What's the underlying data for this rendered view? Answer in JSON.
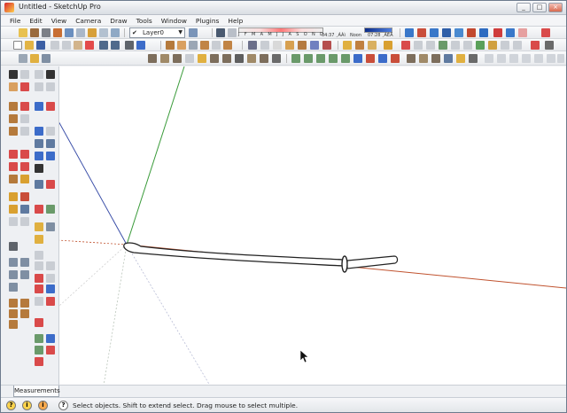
{
  "window": {
    "title": "Untitled - SketchUp Pro",
    "minimize_label": "_",
    "maximize_label": "□",
    "close_label": "×"
  },
  "menu": [
    {
      "label": "File"
    },
    {
      "label": "Edit"
    },
    {
      "label": "View"
    },
    {
      "label": "Camera"
    },
    {
      "label": "Draw"
    },
    {
      "label": "Tools"
    },
    {
      "label": "Window"
    },
    {
      "label": "Plugins"
    },
    {
      "label": "Help"
    }
  ],
  "layers": {
    "current": "Layer0",
    "check": "✔",
    "arrow": "▼"
  },
  "shadows": {
    "months": [
      "J",
      "F",
      "M",
      "A",
      "M",
      "J",
      "J",
      "A",
      "S",
      "O",
      "N",
      "D"
    ],
    "time_left": "04:37 ¸ÁÀì",
    "time_mid": "Noon",
    "time_right": "07:28 ¸ÁÈÄ"
  },
  "measurements_label": "Measurements",
  "status": {
    "info_1": "?",
    "info_2": "i",
    "info_3": "i",
    "help": "?",
    "message": "Select objects. Shift to extend select. Drag mouse to select multiple."
  },
  "colors": {
    "red_axis": "#c0522e",
    "green_axis": "#3a9b3a",
    "blue_axis": "#3a4ea8"
  }
}
